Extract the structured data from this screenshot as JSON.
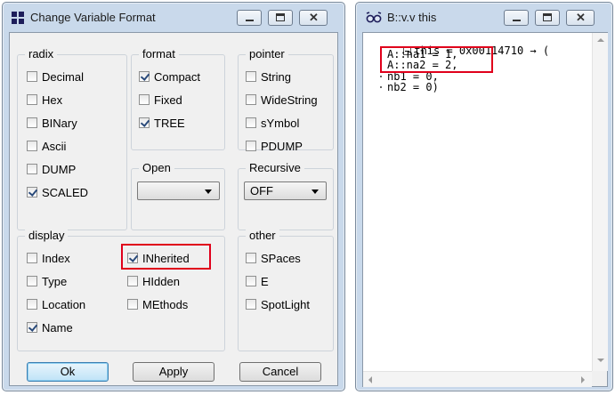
{
  "dialog": {
    "title": "Change Variable Format",
    "radix": {
      "label": "radix",
      "options": [
        {
          "label": "Decimal",
          "checked": false
        },
        {
          "label": "Hex",
          "checked": false
        },
        {
          "label": "BINary",
          "checked": false
        },
        {
          "label": "Ascii",
          "checked": false
        },
        {
          "label": "DUMP",
          "checked": false
        },
        {
          "label": "SCALED",
          "checked": true
        }
      ]
    },
    "format": {
      "label": "format",
      "options": [
        {
          "label": "Compact",
          "checked": true
        },
        {
          "label": "Fixed",
          "checked": false
        },
        {
          "label": "TREE",
          "checked": true
        }
      ]
    },
    "pointer": {
      "label": "pointer",
      "options": [
        {
          "label": "String",
          "checked": false
        },
        {
          "label": "WideString",
          "checked": false
        },
        {
          "label": "sYmbol",
          "checked": false
        },
        {
          "label": "PDUMP",
          "checked": false
        }
      ]
    },
    "open": {
      "label": "Open",
      "value": ""
    },
    "recursive": {
      "label": "Recursive",
      "value": "OFF"
    },
    "display": {
      "label": "display",
      "col1": [
        {
          "label": "Index",
          "checked": false
        },
        {
          "label": "Type",
          "checked": false
        },
        {
          "label": "Location",
          "checked": false
        },
        {
          "label": "Name",
          "checked": true
        }
      ],
      "col2": [
        {
          "label": "INherited",
          "checked": true
        },
        {
          "label": "HIdden",
          "checked": false
        },
        {
          "label": "MEthods",
          "checked": false
        }
      ]
    },
    "other": {
      "label": "other",
      "options": [
        {
          "label": "SPaces",
          "checked": false
        },
        {
          "label": "E",
          "checked": false
        },
        {
          "label": "SpotLight",
          "checked": false
        }
      ]
    },
    "buttons": {
      "ok": "Ok",
      "apply": "Apply",
      "cancel": "Cancel"
    }
  },
  "viewer": {
    "title": "B::v.v this",
    "lines": {
      "root": "this = 0x00114710 → (",
      "l1": "A::na1 = 1,",
      "l2": "A::na2 = 2,",
      "l3": "nb1 = 0,",
      "l4": "nb2 = 0)"
    }
  },
  "icons": [
    "app-grid-icon",
    "minimize-icon",
    "maximize-icon",
    "close-icon",
    "glasses-icon",
    "collapse-tree-icon",
    "chevron-down-icon",
    "scroll-up-icon",
    "scroll-down-icon",
    "scroll-left-icon",
    "scroll-right-icon"
  ]
}
